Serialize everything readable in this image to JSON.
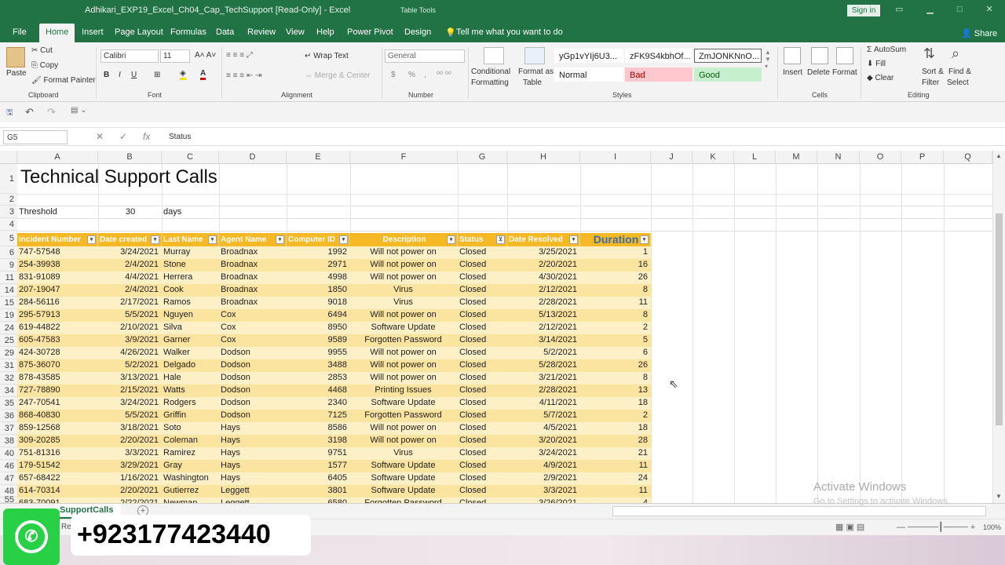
{
  "window": {
    "title": "Adhikari_EXP19_Excel_Ch04_Cap_TechSupport  [Read-Only]  -  Excel",
    "context_tab": "Table Tools",
    "signin": "Sign in"
  },
  "menu": {
    "tabs": [
      "File",
      "Home",
      "Insert",
      "Page Layout",
      "Formulas",
      "Data",
      "Review",
      "View",
      "Help",
      "Power Pivot",
      "Design"
    ],
    "tell_me": "Tell me what you want to do",
    "share": "Share"
  },
  "ribbon": {
    "clipboard": {
      "paste": "Paste",
      "cut": "Cut",
      "copy": "Copy",
      "format_painter": "Format Painter",
      "label": "Clipboard"
    },
    "font": {
      "name": "Calibri",
      "size": "11",
      "label": "Font",
      "bold": "B",
      "italic": "I",
      "underline": "U"
    },
    "alignment": {
      "wrap": "Wrap Text",
      "merge": "Merge & Center",
      "label": "Alignment"
    },
    "number": {
      "format": "General",
      "label": "Number",
      "currency": "$",
      "percent": "%",
      "comma": ","
    },
    "styles": {
      "conditional": "Conditional",
      "conditional2": "Formatting",
      "format_as": "Format as",
      "format_as2": "Table",
      "style1": "yGp1vYIj6U3...",
      "style2": "zFK9S4kbhOf...",
      "style3": "ZmJONKNnO...",
      "normal": "Normal",
      "bad": "Bad",
      "good": "Good",
      "label": "Styles"
    },
    "cells": {
      "insert": "Insert",
      "delete": "Delete",
      "format": "Format",
      "label": "Cells"
    },
    "editing": {
      "autosum": "AutoSum",
      "fill": "Fill",
      "clear": "Clear",
      "sort": "Sort &",
      "sort2": "Filter",
      "find": "Find &",
      "find2": "Select",
      "label": "Editing"
    }
  },
  "formula_bar": {
    "name_box": "G5",
    "fx": "fx",
    "formula": "Status"
  },
  "columns": [
    "A",
    "B",
    "C",
    "D",
    "E",
    "F",
    "G",
    "H",
    "I",
    "J",
    "K",
    "L",
    "M",
    "N",
    "O",
    "P",
    "Q"
  ],
  "sheet": {
    "title": "Technical Support Calls",
    "threshold_label": "Threshold",
    "threshold_value": "30",
    "threshold_unit": "days",
    "headers": [
      "Incident Number",
      "Date created",
      "Last Name",
      "Agent Name",
      "Computer ID",
      "Description",
      "Status",
      "Date Resolved",
      "Duration"
    ],
    "row_numbers": [
      "1",
      "2",
      "3",
      "4",
      "5",
      "6",
      "9",
      "11",
      "14",
      "15",
      "19",
      "24",
      "25",
      "29",
      "31",
      "32",
      "34",
      "35",
      "36",
      "37",
      "38",
      "40",
      "46",
      "47",
      "48",
      "55"
    ],
    "rows": [
      [
        "747-57548",
        "3/24/2021",
        "Murray",
        "Broadnax",
        "1992",
        "Will not power on",
        "Closed",
        "3/25/2021",
        "1"
      ],
      [
        "254-39938",
        "2/4/2021",
        "Stone",
        "Broadnax",
        "2971",
        "Will not power on",
        "Closed",
        "2/20/2021",
        "16"
      ],
      [
        "831-91089",
        "4/4/2021",
        "Herrera",
        "Broadnax",
        "4998",
        "Will not power on",
        "Closed",
        "4/30/2021",
        "26"
      ],
      [
        "207-19047",
        "2/4/2021",
        "Cook",
        "Broadnax",
        "1850",
        "Virus",
        "Closed",
        "2/12/2021",
        "8"
      ],
      [
        "284-56116",
        "2/17/2021",
        "Ramos",
        "Broadnax",
        "9018",
        "Virus",
        "Closed",
        "2/28/2021",
        "11"
      ],
      [
        "295-57913",
        "5/5/2021",
        "Nguyen",
        "Cox",
        "6494",
        "Will not power on",
        "Closed",
        "5/13/2021",
        "8"
      ],
      [
        "619-44822",
        "2/10/2021",
        "Silva",
        "Cox",
        "8950",
        "Software Update",
        "Closed",
        "2/12/2021",
        "2"
      ],
      [
        "605-47583",
        "3/9/2021",
        "Garner",
        "Cox",
        "9589",
        "Forgotten Password",
        "Closed",
        "3/14/2021",
        "5"
      ],
      [
        "424-30728",
        "4/26/2021",
        "Walker",
        "Dodson",
        "9955",
        "Will not power on",
        "Closed",
        "5/2/2021",
        "6"
      ],
      [
        "875-36070",
        "5/2/2021",
        "Delgado",
        "Dodson",
        "3488",
        "Will not power on",
        "Closed",
        "5/28/2021",
        "26"
      ],
      [
        "878-43585",
        "3/13/2021",
        "Hale",
        "Dodson",
        "2853",
        "Will not power on",
        "Closed",
        "3/21/2021",
        "8"
      ],
      [
        "727-78890",
        "2/15/2021",
        "Watts",
        "Dodson",
        "4468",
        "Printing Issues",
        "Closed",
        "2/28/2021",
        "13"
      ],
      [
        "247-70541",
        "3/24/2021",
        "Rodgers",
        "Dodson",
        "2340",
        "Software Update",
        "Closed",
        "4/11/2021",
        "18"
      ],
      [
        "868-40830",
        "5/5/2021",
        "Griffin",
        "Dodson",
        "7125",
        "Forgotten Password",
        "Closed",
        "5/7/2021",
        "2"
      ],
      [
        "859-12568",
        "3/18/2021",
        "Soto",
        "Hays",
        "8586",
        "Will not power on",
        "Closed",
        "4/5/2021",
        "18"
      ],
      [
        "309-20285",
        "2/20/2021",
        "Coleman",
        "Hays",
        "3198",
        "Will not power on",
        "Closed",
        "3/20/2021",
        "28"
      ],
      [
        "751-81316",
        "3/3/2021",
        "Ramirez",
        "Hays",
        "9751",
        "Virus",
        "Closed",
        "3/24/2021",
        "21"
      ],
      [
        "179-51542",
        "3/29/2021",
        "Gray",
        "Hays",
        "1577",
        "Software Update",
        "Closed",
        "4/9/2021",
        "11"
      ],
      [
        "657-68422",
        "1/16/2021",
        "Washington",
        "Hays",
        "6405",
        "Software Update",
        "Closed",
        "2/9/2021",
        "24"
      ],
      [
        "614-70314",
        "2/20/2021",
        "Gutierrez",
        "Leggett",
        "3801",
        "Software Update",
        "Closed",
        "3/3/2021",
        "11"
      ],
      [
        "683-70091",
        "2/22/2021",
        "Newman",
        "Leggett",
        "6580",
        "Forgotten Password",
        "Closed",
        "3/26/2021",
        "4"
      ]
    ]
  },
  "sheet_tab": "SupportCalls",
  "status": {
    "left": "Reco",
    "zoom": "100%"
  },
  "watermark": {
    "line1": "Activate Windows",
    "line2": "Go to Settings to activate Windows."
  },
  "overlay": {
    "phone": "+923177423440"
  }
}
